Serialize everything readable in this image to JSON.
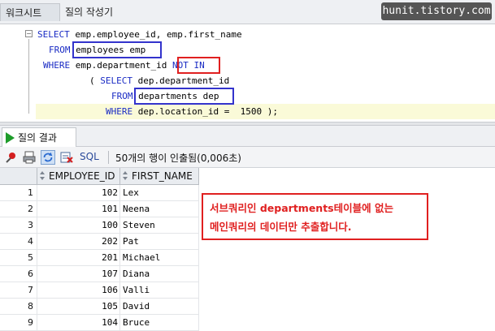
{
  "tabs": {
    "worksheet": "워크시트",
    "query_builder": "질의 작성기"
  },
  "watermark": "hunit.tistory.com",
  "editor": {
    "lines": [
      {
        "kw1": "SELECT",
        "t1": " emp.employee_id, emp.first_name"
      },
      {
        "kw1": "FROM",
        "t1": " employees emp"
      },
      {
        "kw1": "WHERE",
        "t1": " emp.department_id ",
        "kw2": "NOT IN"
      },
      {
        "t0": "( ",
        "kw1": "SELECT",
        "t1": " dep.department_id"
      },
      {
        "kw1": "FROM",
        "t1": " departments dep"
      },
      {
        "kw1": "WHERE",
        "t1": " dep.location_id =  ",
        "num": "1500",
        "t2": " );"
      }
    ]
  },
  "results": {
    "tab_label": "질의 결과",
    "sql_label": "SQL",
    "status": "50개의 행이 인출됨(0,006초)",
    "columns": [
      "EMPLOYEE_ID",
      "FIRST_NAME"
    ],
    "rows": [
      {
        "num": "1",
        "id": "102",
        "name": "Lex"
      },
      {
        "num": "2",
        "id": "101",
        "name": "Neena"
      },
      {
        "num": "3",
        "id": "100",
        "name": "Steven"
      },
      {
        "num": "4",
        "id": "202",
        "name": "Pat"
      },
      {
        "num": "5",
        "id": "201",
        "name": "Michael"
      },
      {
        "num": "6",
        "id": "107",
        "name": "Diana"
      },
      {
        "num": "7",
        "id": "106",
        "name": "Valli"
      },
      {
        "num": "8",
        "id": "105",
        "name": "David"
      },
      {
        "num": "9",
        "id": "104",
        "name": "Bruce"
      }
    ]
  },
  "annotation": {
    "line1": "서브쿼리인 departments테이블에 없는",
    "line2": "메인쿼리의 데이터만 추출합니다."
  },
  "colors": {
    "keyword": "#1a2bc4",
    "highlight_red": "#e02020",
    "highlight_blue": "#3333cc",
    "run_green": "#1e9c2a"
  },
  "icons": [
    "pin-icon",
    "print-icon",
    "refresh-icon",
    "export-icon",
    "run-icon"
  ]
}
